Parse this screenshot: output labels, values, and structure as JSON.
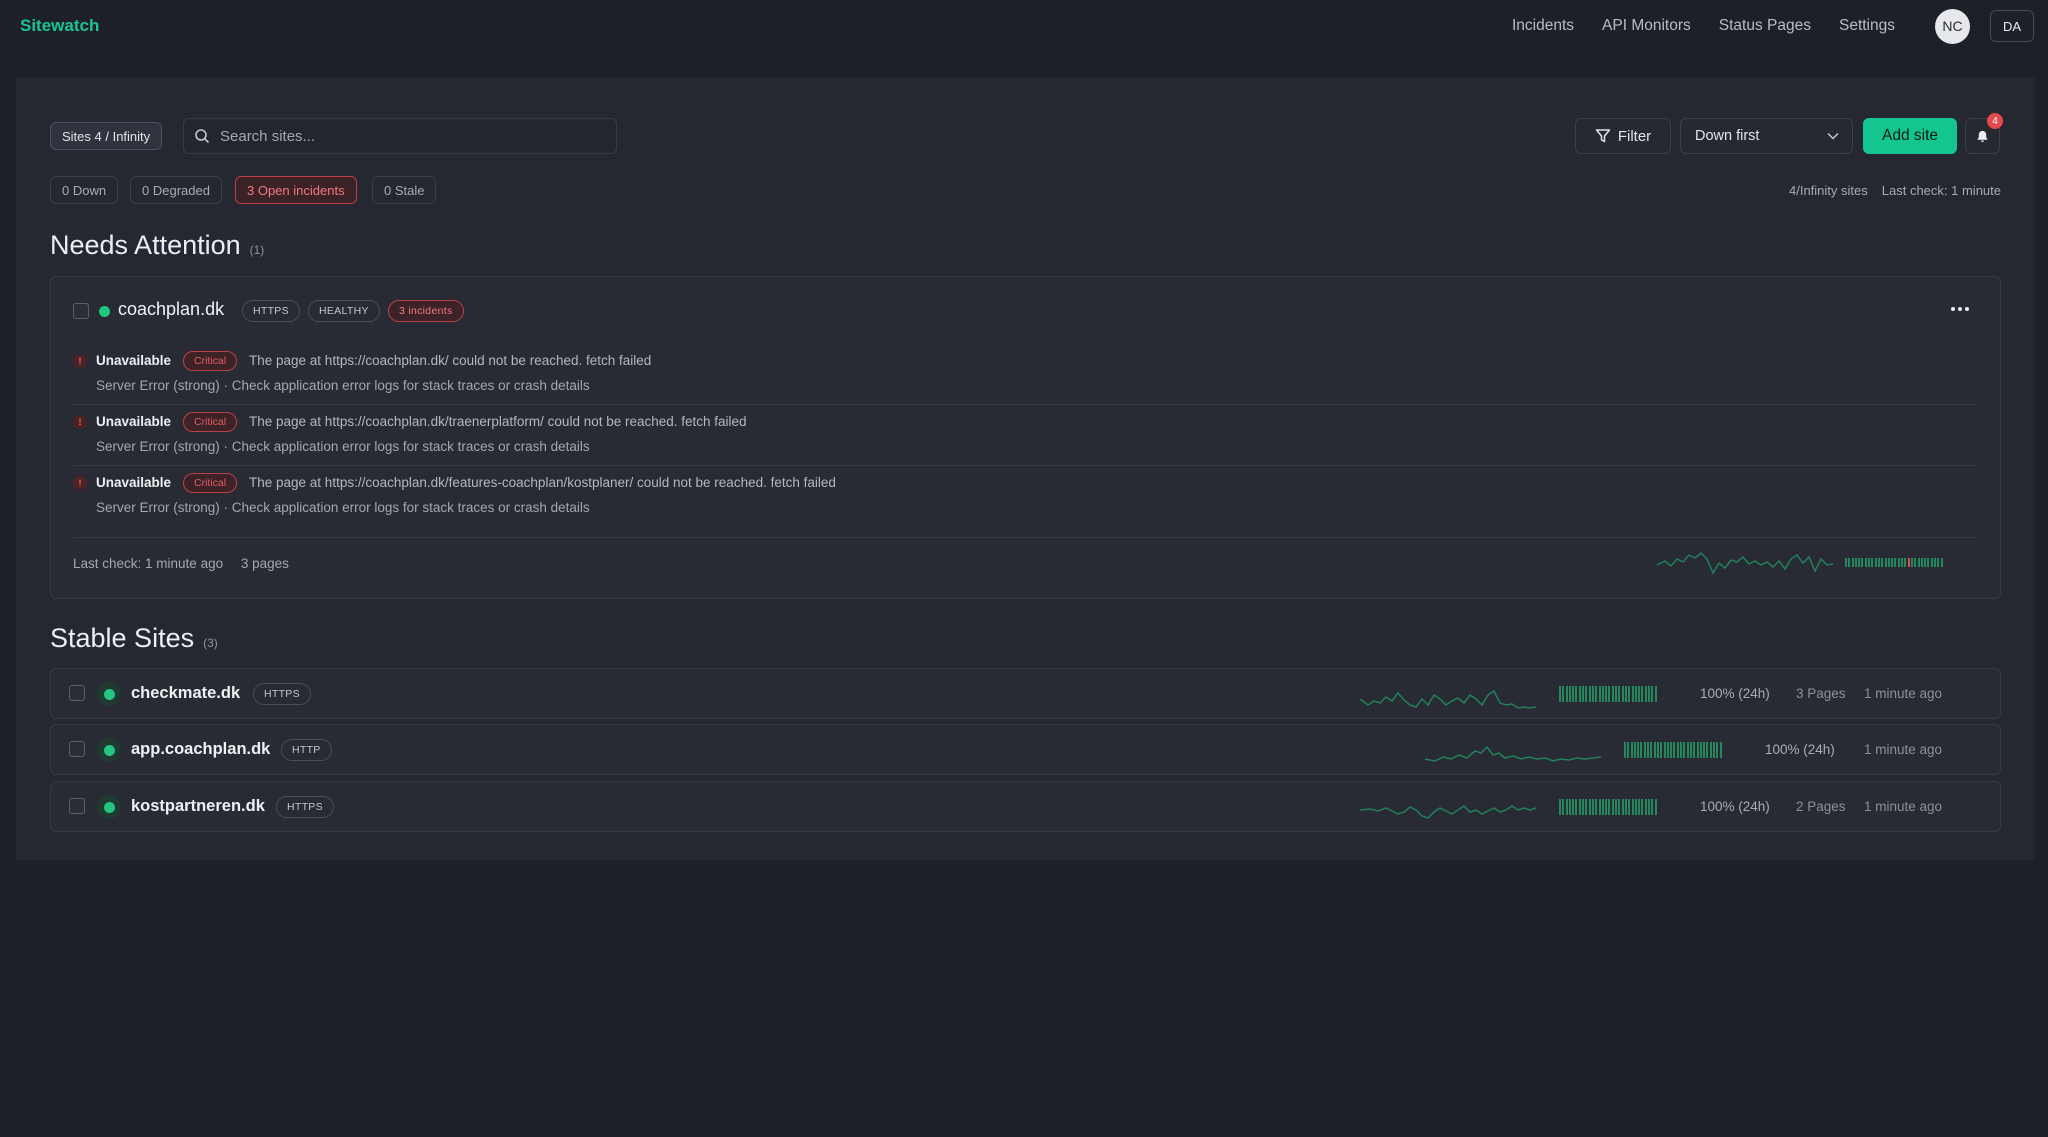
{
  "brand": "Sitewatch",
  "nav": {
    "links": [
      "Incidents",
      "API Monitors",
      "Status Pages",
      "Settings"
    ],
    "avatar_initials": "NC",
    "workspace_initials": "DA"
  },
  "toolbar": {
    "sites_chip": "Sites 4 / Infinity",
    "search_placeholder": "Search sites...",
    "filter_label": "Filter",
    "sort_value": "Down first",
    "add_label": "Add site",
    "notification_count": "4"
  },
  "summary": {
    "down": "0 Down",
    "degraded": "0 Degraded",
    "open_incidents": "3 Open incidents",
    "stale": "0 Stale",
    "sites_count": "4/Infinity sites",
    "last_check": "Last check: 1 minute"
  },
  "needs_attention": {
    "title": "Needs Attention",
    "count": "(1)",
    "site": {
      "host": "coachplan.dk",
      "protocol": "HTTPS",
      "health": "HEALTHY",
      "incidents_badge": "3 incidents",
      "incidents": [
        {
          "label": "Unavailable",
          "severity": "Critical",
          "message": "The page at https://coachplan.dk/ could not be reached. fetch failed",
          "detail": "Server Error (strong) · Check application error logs for stack traces or crash details"
        },
        {
          "label": "Unavailable",
          "severity": "Critical",
          "message": "The page at https://coachplan.dk/traenerplatform/ could not be reached. fetch failed",
          "detail": "Server Error (strong) · Check application error logs for stack traces or crash details"
        },
        {
          "label": "Unavailable",
          "severity": "Critical",
          "message": "The page at https://coachplan.dk/features-coachplan/kostplaner/ could not be reached. fetch failed",
          "detail": "Server Error (strong) · Check application error logs for stack traces or crash details"
        }
      ],
      "last_check": "Last check: 1 minute ago",
      "pages": "3 pages"
    }
  },
  "stable_sites": {
    "title": "Stable Sites",
    "count": "(3)",
    "rows": [
      {
        "host": "checkmate.dk",
        "protocol": "HTTPS",
        "uptime": "100% (24h)",
        "pages": "3 Pages",
        "ago": "1 minute ago"
      },
      {
        "host": "app.coachplan.dk",
        "protocol": "HTTP",
        "uptime": "100% (24h)",
        "pages": "",
        "ago": "1 minute ago"
      },
      {
        "host": "kostpartneren.dk",
        "protocol": "HTTPS",
        "uptime": "100% (24h)",
        "pages": "2 Pages",
        "ago": "1 minute ago"
      }
    ]
  },
  "colors": {
    "brand": "#19c58f",
    "accent": "#13c58e",
    "healthy": "#22c67e",
    "critical": "#e5484d",
    "uptime_bar": "#24885c"
  },
  "icons": [
    "search-icon",
    "filter-icon",
    "chevron-down-icon",
    "bell-icon",
    "more-icon",
    "error-icon"
  ]
}
